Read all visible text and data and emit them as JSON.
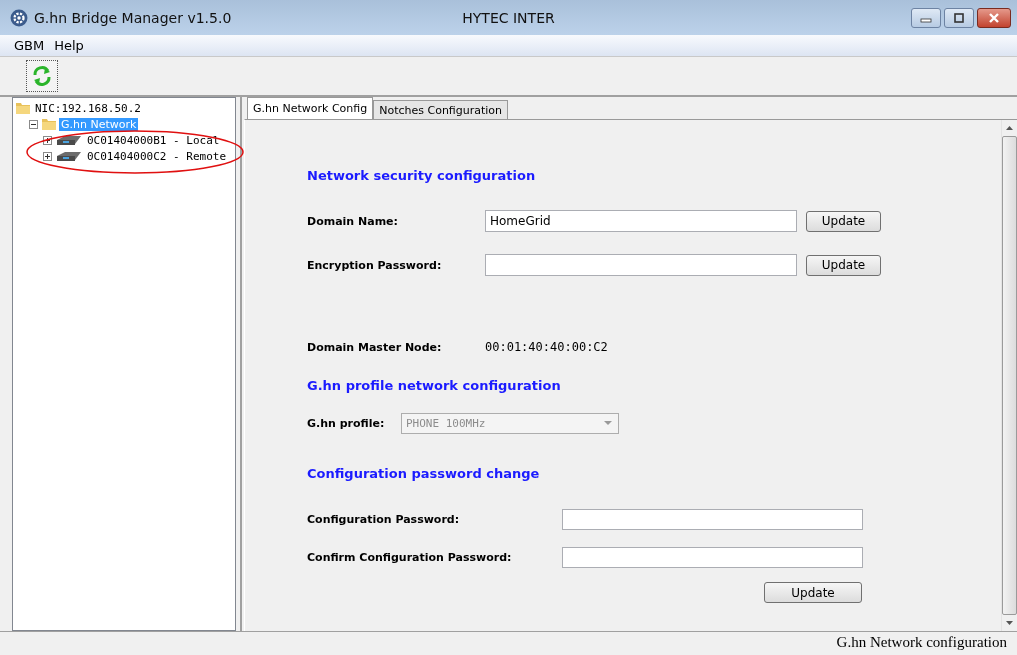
{
  "window": {
    "title": "G.hn Bridge Manager v1.5.0",
    "center_title": "HYTEC INTER"
  },
  "menu": [
    "GBM",
    "Help"
  ],
  "tree": [
    {
      "label": "NIC:192.168.50.2",
      "kind": "folder",
      "selected": false,
      "children": [
        {
          "label": "G.hn Network",
          "kind": "folder",
          "selected": true,
          "expanded": true,
          "children": [
            {
              "label": "0C01404000B1 - Local",
              "kind": "device",
              "selected": false,
              "expanded": false
            },
            {
              "label": "0C01404000C2 - Remote",
              "kind": "device",
              "selected": false,
              "expanded": false
            }
          ]
        }
      ]
    }
  ],
  "tabs": [
    {
      "label": "G.hn Network Config",
      "selected": true
    },
    {
      "label": "Notches Configuration",
      "selected": false
    }
  ],
  "security": {
    "heading": "Network security configuration",
    "fields": [
      {
        "label": "Domain Name:",
        "value": "HomeGrid",
        "button": "Update"
      },
      {
        "label": "Encryption Password:",
        "button": "Update"
      }
    ],
    "master_label": "Domain Master Node:",
    "master_value": "00:01:40:40:00:C2"
  },
  "profile": {
    "heading": "G.hn profile network configuration",
    "label": "G.hn profile:",
    "value": "PHONE 100MHz",
    "disabled": true
  },
  "password": {
    "heading": "Configuration password change",
    "fields": [
      {
        "label": "Configuration Password:"
      },
      {
        "label": "Confirm Configuration Password:"
      }
    ],
    "button": "Update"
  },
  "status_bar": "G.hn Network configuration"
}
